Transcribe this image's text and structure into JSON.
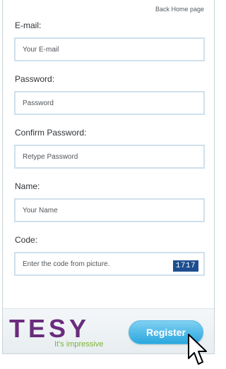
{
  "header": {
    "back_link": "Back Home page"
  },
  "form": {
    "email": {
      "label": "E-mail:",
      "placeholder": "Your E-mail"
    },
    "password": {
      "label": "Password:",
      "placeholder": "Password"
    },
    "confirm": {
      "label": "Confirm Password:",
      "placeholder": "Retype Password"
    },
    "name": {
      "label": "Name:",
      "placeholder": "Your Name"
    },
    "code": {
      "label": "Code:",
      "placeholder": "Enter the code from picture.",
      "captcha": "1717"
    }
  },
  "footer": {
    "logo": "TESY",
    "tagline": "It's impressive",
    "register_label": "Register"
  },
  "colors": {
    "brand_purple": "#6a2c7d",
    "brand_green": "#7bb531",
    "button_blue": "#2aa7de",
    "captcha_bg": "#1d4e8f"
  }
}
